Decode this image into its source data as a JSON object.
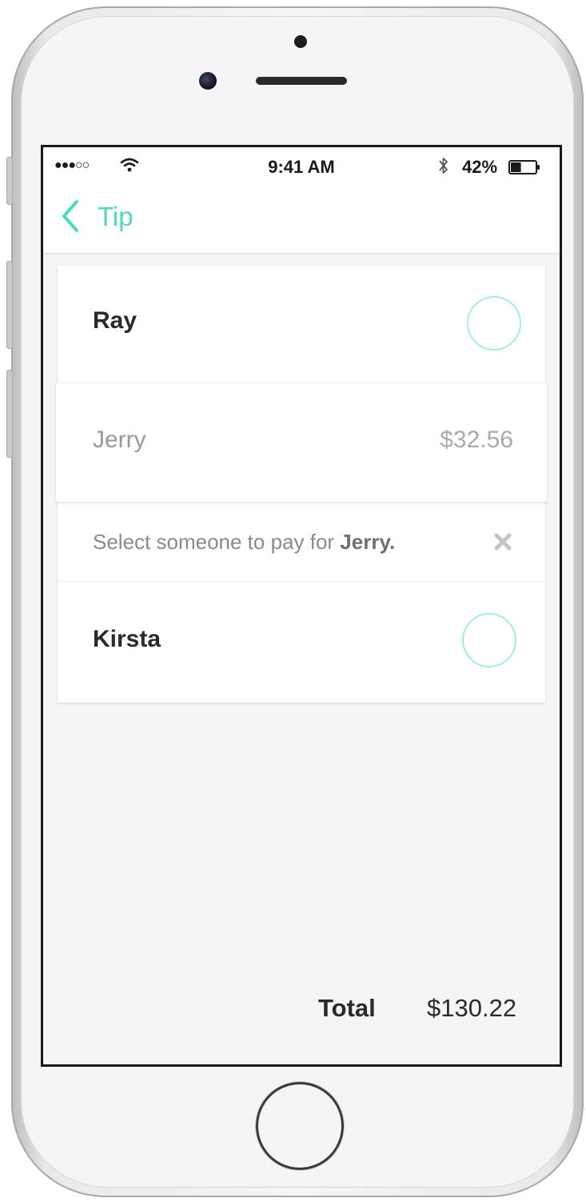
{
  "status_bar": {
    "signal": "●●●○○",
    "time": "9:41 AM",
    "battery_percent": "42%",
    "battery_level": 0.42
  },
  "nav": {
    "back_label": "Tip"
  },
  "list": {
    "ray": {
      "name": "Ray"
    },
    "jerry": {
      "name": "Jerry",
      "amount": "$32.56"
    },
    "select_prompt": {
      "text": "Select someone to pay for ",
      "name": "Jerry",
      "suffix": "."
    },
    "kirsta": {
      "name": "Kirsta"
    }
  },
  "footer": {
    "total_label": "Total",
    "total_value": "$130.22"
  },
  "colors": {
    "accent": "#4fd8bd",
    "circle_border": "#a8ecd9"
  },
  "icons": [
    "wifi-icon",
    "bluetooth-icon",
    "battery-icon",
    "chevron-left-icon",
    "close-icon"
  ]
}
